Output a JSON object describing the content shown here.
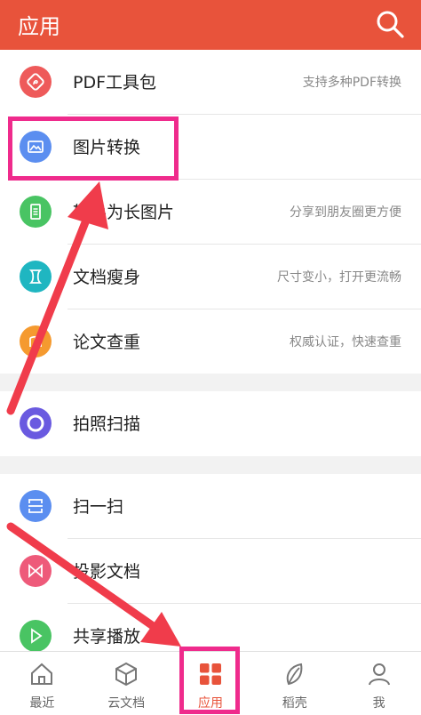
{
  "header": {
    "title": "应用",
    "search_icon": "search-icon"
  },
  "section1": [
    {
      "label": "PDF工具包",
      "desc": "支持多种PDF转换",
      "color": "#ee5a5a",
      "icon": "pdf-icon"
    },
    {
      "label": "图片转换",
      "desc": "",
      "color": "#5b8ef0",
      "icon": "image-icon"
    },
    {
      "label": "转换为长图片",
      "desc": "分享到朋友圈更方便",
      "color": "#49c463",
      "icon": "long-image-icon"
    },
    {
      "label": "文档瘦身",
      "desc": "尺寸变小，打开更流畅",
      "color": "#1fb6c1",
      "icon": "slim-icon"
    },
    {
      "label": "论文查重",
      "desc": "权威认证，快速查重",
      "color": "#f59a2f",
      "icon": "thesis-icon"
    }
  ],
  "section2": [
    {
      "label": "拍照扫描",
      "desc": "",
      "color": "#6a5ae0",
      "icon": "camera-scan-icon"
    }
  ],
  "section3": [
    {
      "label": "扫一扫",
      "desc": "",
      "color": "#5b8ef0",
      "icon": "scan-icon"
    },
    {
      "label": "投影文档",
      "desc": "",
      "color": "#ee5a7a",
      "icon": "projection-icon"
    },
    {
      "label": "共享播放",
      "desc": "",
      "color": "#49c463",
      "icon": "play-icon"
    }
  ],
  "bottom_nav": [
    {
      "label": "最近",
      "icon": "home-icon",
      "active": false
    },
    {
      "label": "云文档",
      "icon": "cloud-box-icon",
      "active": false
    },
    {
      "label": "应用",
      "icon": "apps-grid-icon",
      "active": true
    },
    {
      "label": "稻壳",
      "icon": "leaf-icon",
      "active": false
    },
    {
      "label": "我",
      "icon": "profile-icon",
      "active": false
    }
  ],
  "colors": {
    "brand": "#e8533b",
    "highlight": "#ef2b8c",
    "arrow": "#f03c4b"
  }
}
